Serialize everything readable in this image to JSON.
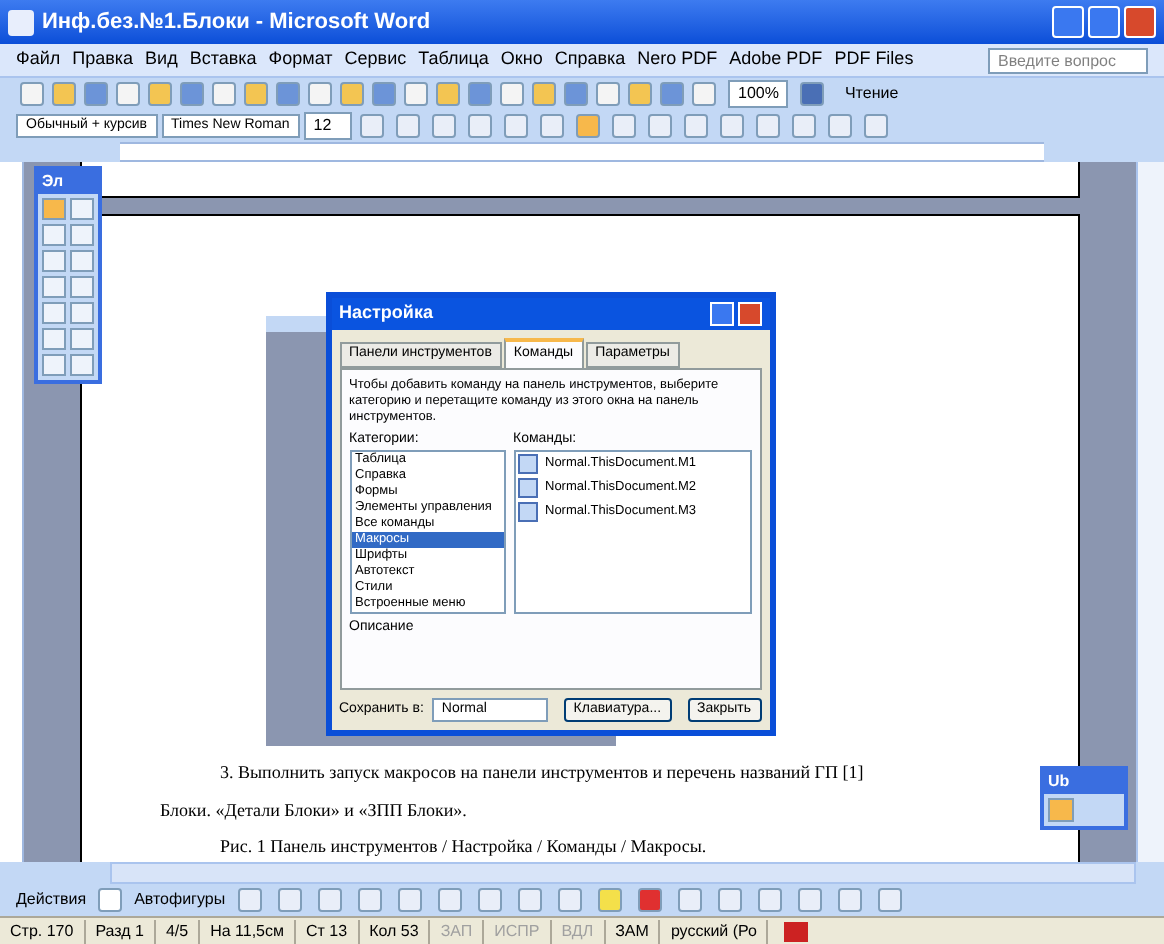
{
  "window": {
    "title": "Инф.без.№1.Блоки - Microsoft Word"
  },
  "menu": {
    "items": [
      "Файл",
      "Правка",
      "Вид",
      "Вставка",
      "Формат",
      "Сервис",
      "Таблица",
      "Окно",
      "Справка",
      "Nero PDF",
      "Adobe PDF",
      "PDF Files"
    ],
    "help_placeholder": "Введите вопрос"
  },
  "formatting": {
    "style": "Обычный + курсив",
    "font": "Times New Roman",
    "size": "12",
    "zoom": "100%",
    "read_button": "Чтение"
  },
  "float_toolbar": {
    "title": "Эл"
  },
  "small_toolbar": {
    "title": "Ub"
  },
  "dialog": {
    "title": "Настройка",
    "tabs": [
      {
        "label": "Панели инструментов",
        "selected": false
      },
      {
        "label": "Команды",
        "selected": true
      },
      {
        "label": "Параметры",
        "selected": false
      }
    ],
    "description": "Чтобы добавить команду на панель инструментов, выберите категорию и перетащите команду из этого окна на панель инструментов.",
    "categories_label": "Категории:",
    "categories": [
      {
        "label": "Таблица",
        "selected": false
      },
      {
        "label": "Справка",
        "selected": false
      },
      {
        "label": "Формы",
        "selected": false
      },
      {
        "label": "Элементы управления",
        "selected": false
      },
      {
        "label": "Все команды",
        "selected": false
      },
      {
        "label": "Макросы",
        "selected": true
      },
      {
        "label": "Шрифты",
        "selected": false
      },
      {
        "label": "Автотекст",
        "selected": false
      },
      {
        "label": "Стили",
        "selected": false
      },
      {
        "label": "Встроенные меню",
        "selected": false
      }
    ],
    "commands_label": "Команды:",
    "commands": [
      "Normal.ThisDocument.М1",
      "Normal.ThisDocument.М2",
      "Normal.ThisDocument.М3"
    ],
    "description_label": "Описание",
    "save_label": "Сохранить в:",
    "save_value": "Normal",
    "buttons": [
      "Клавиатура...",
      "Закрыть"
    ]
  },
  "document": {
    "paragraphs": [
      "3. Выполнить запуск макросов на панели инструментов и перечень названий ГП [1]",
      "Блоки. «Детали Блоки» и «ЗПП Блоки».",
      "Рис. 1 Панель инструментов / Настройка / Команды / Макросы."
    ]
  },
  "drawing_toolbar": {
    "actions": "Действия",
    "autoshapes": "Автофигуры"
  },
  "status_bar": [
    "Стр. 170",
    "Разд 1",
    "4/5",
    "На 11,5см",
    "Ст 13",
    "Кол 53",
    "ЗАП",
    "ИСПР",
    "ВДЛ",
    "ЗАМ",
    "русский (Ро"
  ]
}
